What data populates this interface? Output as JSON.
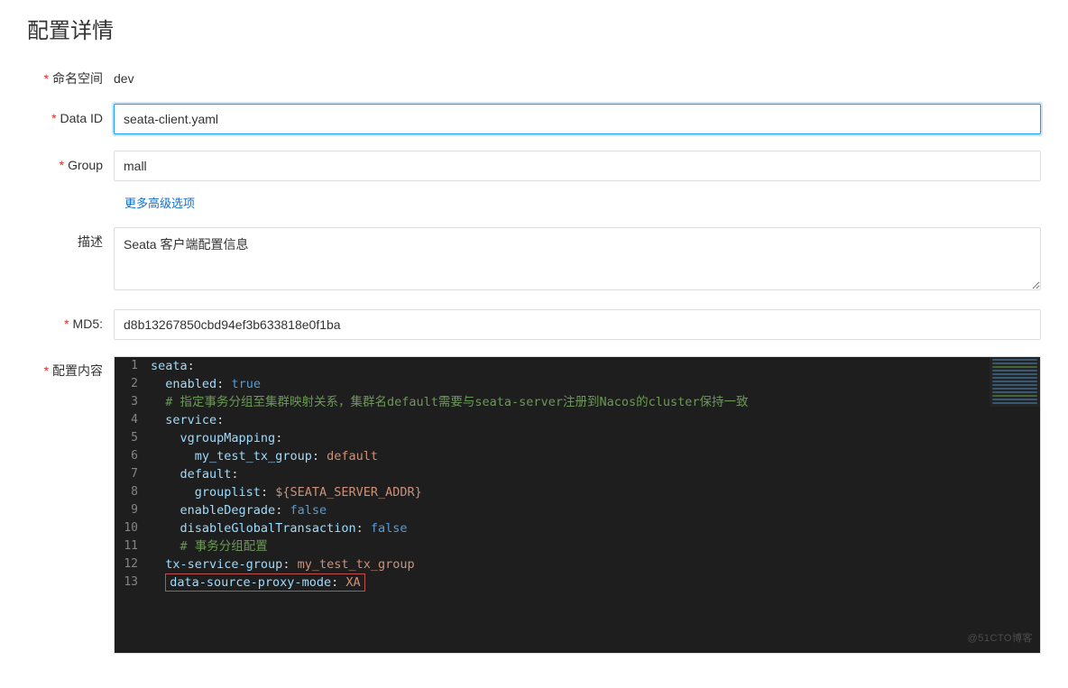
{
  "page_title": "配置详情",
  "labels": {
    "namespace": "命名空间",
    "data_id": "Data ID",
    "group": "Group",
    "description": "描述",
    "md5": "MD5:",
    "content": "配置内容"
  },
  "values": {
    "namespace": "dev",
    "data_id": "seata-client.yaml",
    "group": "mall",
    "description": "Seata 客户端配置信息",
    "md5": "d8b13267850cbd94ef3b633818e0f1ba"
  },
  "more_options": "更多高级选项",
  "code": {
    "lines": [
      {
        "n": 1,
        "segments": [
          {
            "t": "seata",
            "c": "tok-key"
          },
          {
            "t": ":",
            "c": "tok-punct"
          }
        ]
      },
      {
        "n": 2,
        "segments": [
          {
            "t": "  "
          },
          {
            "t": "enabled",
            "c": "tok-key"
          },
          {
            "t": ": ",
            "c": "tok-punct"
          },
          {
            "t": "true",
            "c": "tok-bool"
          }
        ]
      },
      {
        "n": 3,
        "segments": [
          {
            "t": "  "
          },
          {
            "t": "# 指定事务分组至集群映射关系，集群名default需要与seata-server注册到Nacos的cluster保持一致",
            "c": "tok-cmt"
          }
        ]
      },
      {
        "n": 4,
        "segments": [
          {
            "t": "  "
          },
          {
            "t": "service",
            "c": "tok-key"
          },
          {
            "t": ":",
            "c": "tok-punct"
          }
        ]
      },
      {
        "n": 5,
        "segments": [
          {
            "t": "    "
          },
          {
            "t": "vgroupMapping",
            "c": "tok-key"
          },
          {
            "t": ":",
            "c": "tok-punct"
          }
        ]
      },
      {
        "n": 6,
        "segments": [
          {
            "t": "      "
          },
          {
            "t": "my_test_tx_group",
            "c": "tok-key"
          },
          {
            "t": ": ",
            "c": "tok-punct"
          },
          {
            "t": "default",
            "c": "tok-str"
          }
        ]
      },
      {
        "n": 7,
        "segments": [
          {
            "t": "    "
          },
          {
            "t": "default",
            "c": "tok-key"
          },
          {
            "t": ":",
            "c": "tok-punct"
          }
        ]
      },
      {
        "n": 8,
        "segments": [
          {
            "t": "      "
          },
          {
            "t": "grouplist",
            "c": "tok-key"
          },
          {
            "t": ": ",
            "c": "tok-punct"
          },
          {
            "t": "${SEATA_SERVER_ADDR}",
            "c": "tok-var"
          }
        ]
      },
      {
        "n": 9,
        "segments": [
          {
            "t": "    "
          },
          {
            "t": "enableDegrade",
            "c": "tok-key"
          },
          {
            "t": ": ",
            "c": "tok-punct"
          },
          {
            "t": "false",
            "c": "tok-bool"
          }
        ]
      },
      {
        "n": 10,
        "segments": [
          {
            "t": "    "
          },
          {
            "t": "disableGlobalTransaction",
            "c": "tok-key"
          },
          {
            "t": ": ",
            "c": "tok-punct"
          },
          {
            "t": "false",
            "c": "tok-bool"
          }
        ]
      },
      {
        "n": 11,
        "segments": [
          {
            "t": "    "
          },
          {
            "t": "# 事务分组配置",
            "c": "tok-cmt"
          }
        ]
      },
      {
        "n": 12,
        "segments": [
          {
            "t": "  "
          },
          {
            "t": "tx-service-group",
            "c": "tok-key"
          },
          {
            "t": ": ",
            "c": "tok-punct"
          },
          {
            "t": "my_test_tx_group",
            "c": "tok-str"
          }
        ]
      },
      {
        "n": 13,
        "highlight": true,
        "segments": [
          {
            "t": "  "
          },
          {
            "t": "data-source-proxy-mode",
            "c": "tok-key"
          },
          {
            "t": ": ",
            "c": "tok-punct"
          },
          {
            "t": "XA",
            "c": "tok-str"
          }
        ]
      }
    ]
  },
  "watermark": "@51CTO博客"
}
